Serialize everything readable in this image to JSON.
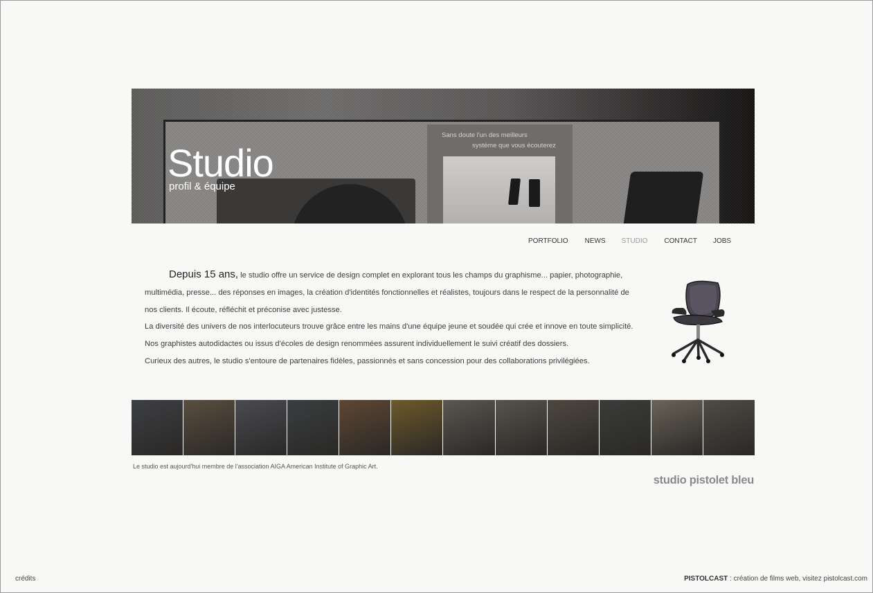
{
  "hero": {
    "title": "Studio",
    "subtitle": "profil & équipe",
    "poster_line1": "Sans doute l'un des meilleurs",
    "poster_line2": "système que vous écouterez"
  },
  "nav": {
    "items": [
      {
        "label": "PORTFOLIO",
        "active": false
      },
      {
        "label": "NEWS",
        "active": false
      },
      {
        "label": "STUDIO",
        "active": true
      },
      {
        "label": "CONTACT",
        "active": false
      },
      {
        "label": "JOBS",
        "active": false
      }
    ]
  },
  "intro": {
    "lead": "Depuis 15 ans,",
    "p1": " le studio offre un service de design complet en explorant tous les champs du graphisme... papier, photographie, multimédia, presse... des réponses en images, la création d'identités fonctionnelles et réalistes, toujours dans le respect de la personnalité de nos clients. Il écoute, réfléchit et préconise avec justesse.",
    "p2": "La diversité des univers de nos interlocuteurs trouve grâce entre les mains d'une équipe jeune et soudée qui crée et innove en toute simplicité. Nos graphistes autodidactes ou issus d'écoles de design renommées assurent individuellement le suivi créatif des dossiers.",
    "p3": "Curieux des autres, le studio s'entoure de partenaires fidèles, passionnés et sans concession pour des collaborations privilégiées."
  },
  "thumbnails": [
    {
      "name": "office-window",
      "color": "#3d3f43"
    },
    {
      "name": "photo-frames",
      "color": "#5a4e3f"
    },
    {
      "name": "desk-lamp-dusk",
      "color": "#4a4b52"
    },
    {
      "name": "shelves",
      "color": "#3a3e40"
    },
    {
      "name": "warm-room",
      "color": "#5e4733"
    },
    {
      "name": "lamp-shade",
      "color": "#6e5a2a"
    },
    {
      "name": "meeting-table",
      "color": "#5b5752"
    },
    {
      "name": "workspace",
      "color": "#57544c"
    },
    {
      "name": "team-people",
      "color": "#4e483f"
    },
    {
      "name": "desk-lamp",
      "color": "#3a3d3b"
    },
    {
      "name": "monitor",
      "color": "#6a6459"
    },
    {
      "name": "desk-corner",
      "color": "#4f4b45"
    }
  ],
  "member_note": "Le studio est aujourd'hui membre de l'association AIGA American Institute of Graphic Art.",
  "brand": "studio pistolet bleu",
  "footer": {
    "credits": "crédits",
    "pistolcast": "PISTOLCAST",
    "pistolcast_text": " : création de films web, visitez pistolcast.com"
  }
}
